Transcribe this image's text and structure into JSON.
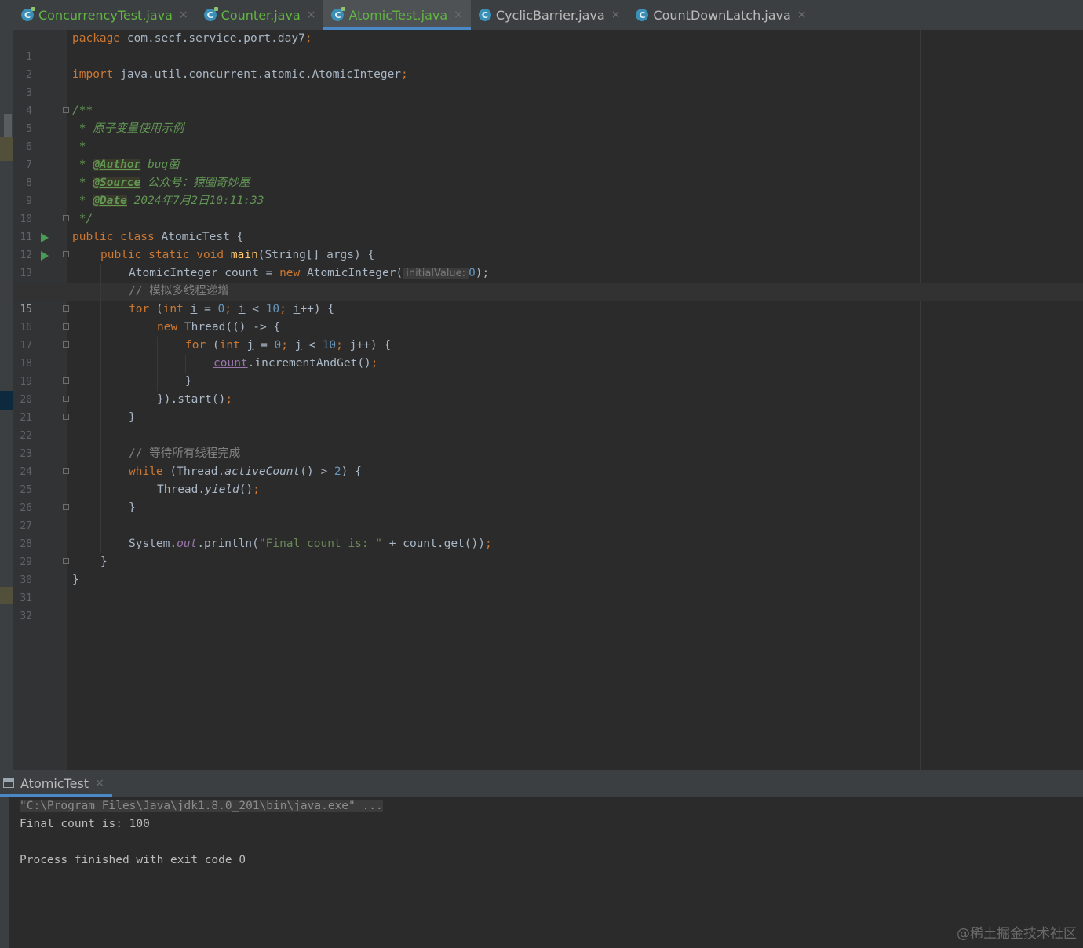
{
  "tabs": [
    {
      "label": "ConcurrencyTest.java",
      "modified": true,
      "active": false
    },
    {
      "label": "Counter.java",
      "modified": true,
      "active": false
    },
    {
      "label": "AtomicTest.java",
      "modified": true,
      "active": true
    },
    {
      "label": "CyclicBarrier.java",
      "modified": false,
      "active": false
    },
    {
      "label": "CountDownLatch.java",
      "modified": false,
      "active": false
    }
  ],
  "editor": {
    "current_line": 15,
    "line_numbers": [
      "1",
      "2",
      "3",
      "4",
      "5",
      "6",
      "7",
      "8",
      "9",
      "10",
      "11",
      "12",
      "13",
      "14",
      "15",
      "16",
      "17",
      "18",
      "19",
      "20",
      "21",
      "22",
      "23",
      "24",
      "25",
      "26",
      "27",
      "28",
      "29",
      "30",
      "31",
      "32"
    ],
    "code": {
      "l1": {
        "kw": "package",
        "rest": " com.secf.service.port.day7",
        "semi": ";"
      },
      "l3": {
        "kw": "import",
        "rest": " java.util.concurrent.atomic.AtomicInteger",
        "semi": ";"
      },
      "l5": "/**",
      "l6": " * 原子变量使用示例",
      "l7": " *",
      "l8": {
        "prefix": " * ",
        "tag": "@Author",
        "text": " bug菌"
      },
      "l9": {
        "prefix": " * ",
        "tag": "@Source",
        "text": " 公众号：猿圈奇妙屋"
      },
      "l10": {
        "prefix": " * ",
        "tag": "@Date",
        "text": " 2024年7月2日10:11:33"
      },
      "l11": " */",
      "l12": {
        "kw": "public class",
        "rest": " AtomicTest {"
      },
      "l13": {
        "kw": "public static void",
        "fn": "main",
        "rest": "(String[] args) {"
      },
      "l14": {
        "a": "AtomicInteger count = ",
        "kw": "new",
        "b": " AtomicInteger(",
        "hint": "initialValue:",
        "num": "0",
        "c": ");"
      },
      "l15": "// 模拟多线程递增",
      "l16": {
        "kw": "for",
        "a": " (",
        "kw2": "int",
        "var": "i",
        "b": " = ",
        "n0": "0",
        "c": "; ",
        "var2": "i",
        "d": " < ",
        "n10": "10",
        "e": "; ",
        "var3": "i",
        "f": "++) {"
      },
      "l17": {
        "kw": "new",
        "rest": " Thread(() -> {"
      },
      "l18": {
        "kw": "for",
        "a": " (",
        "kw2": "int",
        "var": "j",
        "b": " = ",
        "n0": "0",
        "c": "; ",
        "var2": "j",
        "d": " < ",
        "n10": "10",
        "e": "; ",
        "var3": "j",
        "f": "++) {"
      },
      "l19": {
        "field": "count",
        "rest": ".incrementAndGet()",
        "semi": ";"
      },
      "l20": "}",
      "l21": {
        "rest": "}).start()",
        "semi": ";"
      },
      "l22": "}",
      "l24": "// 等待所有线程完成",
      "l25": {
        "kw": "while",
        "a": " (Thread.",
        "it": "activeCount",
        "b": "() > ",
        "num": "2",
        "c": ") {"
      },
      "l26": {
        "a": "Thread.",
        "it": "yield",
        "b": "()",
        "semi": ";"
      },
      "l27": "}",
      "l29": {
        "a": "System.",
        "st": "out",
        "b": ".println(",
        "str": "\"Final count is: \"",
        "c": " + count.get())",
        "semi": ";"
      },
      "l30": "}",
      "l31": "}"
    }
  },
  "run_panel": {
    "tab_label": "AtomicTest",
    "close": "×",
    "console": {
      "command": "\"C:\\Program Files\\Java\\jdk1.8.0_201\\bin\\java.exe\" ...",
      "output": "Final count is: 100",
      "exit": "Process finished with exit code 0"
    }
  },
  "watermark": "@稀土掘金技术社区",
  "colors": {
    "keyword": "#cc7832",
    "number": "#6897bb",
    "string": "#6a8759",
    "doc": "#629755",
    "method": "#ffc66d",
    "field": "#9876aa",
    "accent": "#4a88c7",
    "run": "#499c54"
  },
  "icons": {
    "tab": "java-class-icon",
    "run": "run-gutter-icon",
    "fold": "fold-icon",
    "console": "console-icon",
    "close": "close-icon"
  }
}
